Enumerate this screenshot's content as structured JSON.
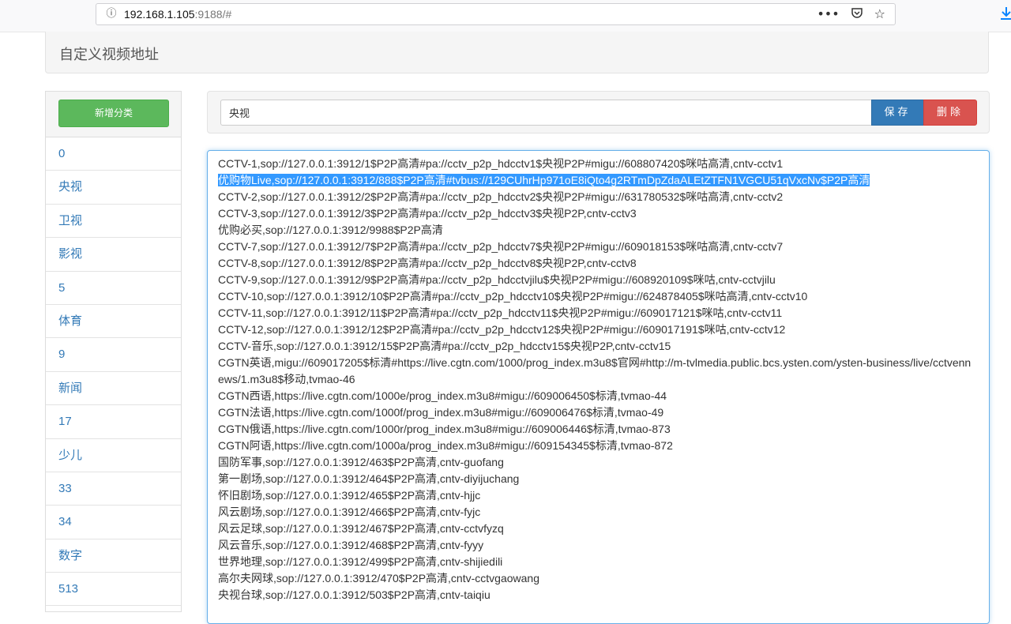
{
  "browser": {
    "url_host": "192.168.1.105",
    "url_rest": ":9188/#",
    "icons": [
      "info-icon",
      "more-icon",
      "pocket-icon",
      "bookmark-star-icon",
      "download-icon"
    ]
  },
  "header": {
    "title": "自定义视频地址"
  },
  "sidebar": {
    "add_label": "新增分类",
    "items": [
      "0",
      "央视",
      "卫视",
      "影视",
      "5",
      "体育",
      "9",
      "新闻",
      "17",
      "少儿",
      "33",
      "34",
      "数字",
      "513"
    ]
  },
  "editor": {
    "name_value": "央视",
    "save_label": "保存",
    "delete_label": "删除",
    "lines": [
      "CCTV-1,sop://127.0.0.1:3912/1$P2P高清#pa://cctv_p2p_hdcctv1$央视P2P#migu://608807420$咪咕高清,cntv-cctv1",
      "优购物Live,sop://127.0.0.1:3912/888$P2P高清#tvbus://129CUhrHp971oE8iQto4g2RTmDpZdaALEtZTFN1VGCU51qVxcNv$P2P高清",
      "CCTV-2,sop://127.0.0.1:3912/2$P2P高清#pa://cctv_p2p_hdcctv2$央视P2P#migu://631780532$咪咕高清,cntv-cctv2",
      "CCTV-3,sop://127.0.0.1:3912/3$P2P高清#pa://cctv_p2p_hdcctv3$央视P2P,cntv-cctv3",
      "优购必买,sop://127.0.0.1:3912/9988$P2P高清",
      "CCTV-7,sop://127.0.0.1:3912/7$P2P高清#pa://cctv_p2p_hdcctv7$央视P2P#migu://609018153$咪咕高清,cntv-cctv7",
      "CCTV-8,sop://127.0.0.1:3912/8$P2P高清#pa://cctv_p2p_hdcctv8$央视P2P,cntv-cctv8",
      "CCTV-9,sop://127.0.0.1:3912/9$P2P高清#pa://cctv_p2p_hdcctvjilu$央视P2P#migu://608920109$咪咕,cntv-cctvjilu",
      "CCTV-10,sop://127.0.0.1:3912/10$P2P高清#pa://cctv_p2p_hdcctv10$央视P2P#migu://624878405$咪咕高清,cntv-cctv10",
      "CCTV-11,sop://127.0.0.1:3912/11$P2P高清#pa://cctv_p2p_hdcctv11$央视P2P#migu://609017121$咪咕,cntv-cctv11",
      "CCTV-12,sop://127.0.0.1:3912/12$P2P高清#pa://cctv_p2p_hdcctv12$央视P2P#migu://609017191$咪咕,cntv-cctv12",
      "CCTV-音乐,sop://127.0.0.1:3912/15$P2P高清#pa://cctv_p2p_hdcctv15$央视P2P,cntv-cctv15",
      "CGTN英语,migu://609017205$标清#https://live.cgtn.com/1000/prog_index.m3u8$官网#http://m-tvlmedia.public.bcs.ysten.com/ysten-business/live/cctvennews/1.m3u8$移动,tvmao-46",
      "CGTN西语,https://live.cgtn.com/1000e/prog_index.m3u8#migu://609006450$标清,tvmao-44",
      "CGTN法语,https://live.cgtn.com/1000f/prog_index.m3u8#migu://609006476$标清,tvmao-49",
      "CGTN俄语,https://live.cgtn.com/1000r/prog_index.m3u8#migu://609006446$标清,tvmao-873",
      "CGTN阿语,https://live.cgtn.com/1000a/prog_index.m3u8#migu://609154345$标清,tvmao-872",
      "国防军事,sop://127.0.0.1:3912/463$P2P高清,cntv-guofang",
      "第一剧场,sop://127.0.0.1:3912/464$P2P高清,cntv-diyijuchang",
      "怀旧剧场,sop://127.0.0.1:3912/465$P2P高清,cntv-hjjc",
      "风云剧场,sop://127.0.0.1:3912/466$P2P高清,cntv-fyjc",
      "风云足球,sop://127.0.0.1:3912/467$P2P高清,cntv-cctvfyzq",
      "风云音乐,sop://127.0.0.1:3912/468$P2P高清,cntv-fyyy",
      "世界地理,sop://127.0.0.1:3912/499$P2P高清,cntv-shijiedili",
      "高尔夫网球,sop://127.0.0.1:3912/470$P2P高清,cntv-cctvgaowang",
      "央视台球,sop://127.0.0.1:3912/503$P2P高清,cntv-taiqiu"
    ],
    "selected_line": 1
  }
}
